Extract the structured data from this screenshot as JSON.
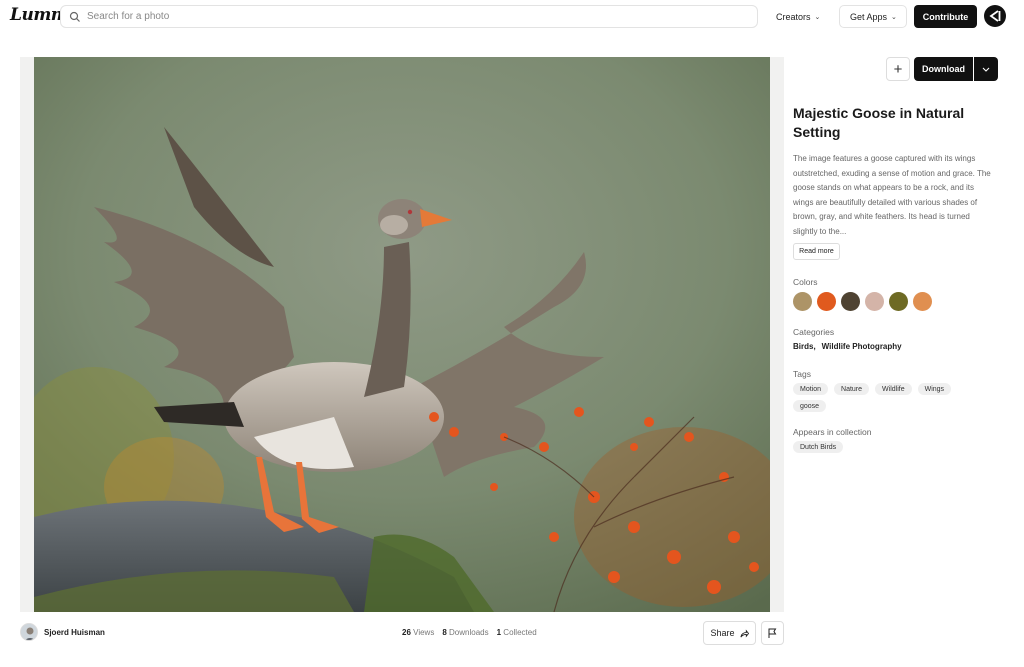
{
  "header": {
    "logo_text": "Lummi",
    "search_placeholder": "Search for a photo",
    "creators_label": "Creators",
    "get_apps_label": "Get Apps",
    "contribute_label": "Contribute"
  },
  "photo": {
    "alt": "Goose with wings outstretched on a mossy rock with orange foliage"
  },
  "footer": {
    "author": "Sjoerd Huisman",
    "views_count": "26",
    "views_label": "Views",
    "downloads_count": "8",
    "downloads_label": "Downloads",
    "collected_count": "1",
    "collected_label": "Collected",
    "share_label": "Share"
  },
  "sidebar": {
    "download_label": "Download",
    "title": "Majestic Goose in Natural Setting",
    "description": "The image features a goose captured with its wings outstretched, exuding a sense of motion and grace. The goose stands on what appears to be a rock, and its wings are beautifully detailed with various shades of brown, gray, and white feathers. Its head is turned slightly to the...",
    "read_more_label": "Read more",
    "colors_label": "Colors",
    "colors": [
      "#ad9467",
      "#e05a1e",
      "#4f4332",
      "#d4b4a8",
      "#6e6a24",
      "#e08f50"
    ],
    "categories_label": "Categories",
    "categories": [
      "Birds,",
      "Wildlife Photography"
    ],
    "tags_label": "Tags",
    "tags": [
      "Motion",
      "Nature",
      "Wildlife",
      "Wings",
      "goose"
    ],
    "collection_label": "Appears in collection",
    "collections": [
      "Dutch Birds"
    ]
  }
}
